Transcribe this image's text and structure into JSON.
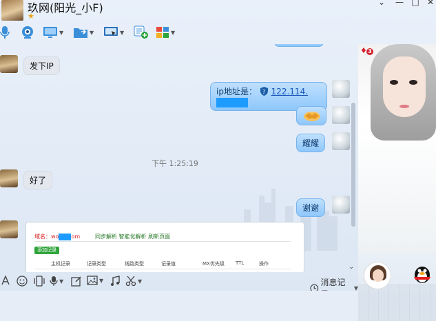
{
  "window": {
    "title": "玖网(阳光_小F)",
    "star": "★",
    "controls": {
      "menu": "⌄",
      "minimize": "—",
      "maximize": "□",
      "close": "✕"
    }
  },
  "toolbar": {
    "icons": [
      "voice-call-icon",
      "video-call-icon",
      "remote-desktop-icon",
      "file-transfer-icon",
      "screen-share-icon",
      "group-chat-icon",
      "apps-icon"
    ]
  },
  "chat": {
    "messages": [
      {
        "side": "left",
        "text": "发下IP"
      },
      {
        "side": "right",
        "prefix": "ip地址是：",
        "link": "122.114."
      },
      {
        "side": "right",
        "emoji": "handshake"
      },
      {
        "side": "right",
        "text": "耀耀"
      },
      {
        "side": "left",
        "text": "好了"
      },
      {
        "side": "right",
        "text": "谢谢"
      }
    ],
    "timestamp": "下午 1:25:19",
    "screenshot": {
      "domain_prefix": "域名：wo",
      "domain_suffix": "om",
      "links": "同步解析  智能化解析  刷新页面",
      "add_button": "添加记录",
      "columns": [
        "主机记录",
        "记录类型",
        "线路类型",
        "记录值",
        "MX优先级",
        "TTL",
        "操作"
      ]
    }
  },
  "input_toolbar": {
    "icons": [
      "font-icon",
      "emoji-icon",
      "vibrate-icon",
      "voice-message-icon",
      "screenshot-edit-icon",
      "image-icon",
      "music-icon",
      "scissors-icon"
    ],
    "history_label": "消息记录"
  },
  "profile": {
    "badge_count": "3"
  },
  "colors": {
    "bubble_right": "#8ec7fb",
    "bubble_left": "#e4e8ee",
    "link": "#1a55b8",
    "redact": "#1e9bff"
  }
}
